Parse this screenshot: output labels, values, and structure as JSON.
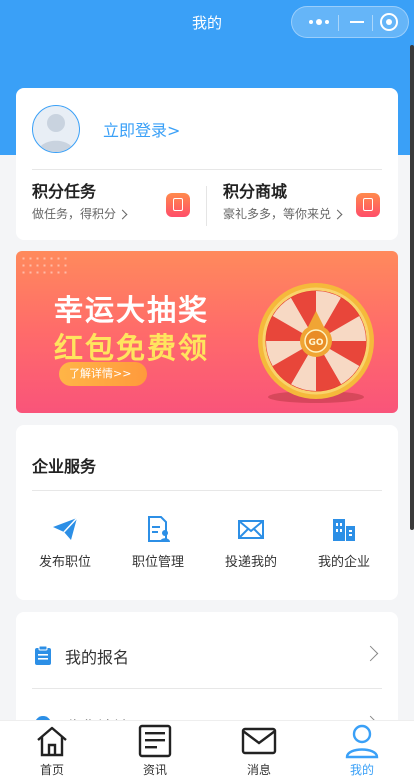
{
  "header": {
    "title": "我的",
    "accent_color": "#3aa0f7",
    "capsule": {
      "more_icon": "more-dots-icon",
      "minimize_icon": "minimize-icon",
      "close_icon": "target-close-icon"
    }
  },
  "profile": {
    "login_label": "立即登录>",
    "points_task": {
      "title": "积分任务",
      "subtitle": "做任务，得积分",
      "icon": "clipboard-icon"
    },
    "points_mall": {
      "title": "积分商城",
      "subtitle": "豪礼多多，等你来兑",
      "icon": "gift-bag-icon"
    }
  },
  "banner": {
    "line1": "幸运大抽奖",
    "line2": "红包免费领",
    "button_label": "了解详情>>",
    "wheel_center_label": "GO"
  },
  "services": {
    "title": "企业服务",
    "items": [
      {
        "label": "发布职位",
        "icon": "paper-plane-icon"
      },
      {
        "label": "职位管理",
        "icon": "document-person-icon"
      },
      {
        "label": "投递我的",
        "icon": "envelope-icon"
      },
      {
        "label": "我的企业",
        "icon": "building-icon"
      }
    ]
  },
  "list": [
    {
      "label": "我的报名",
      "icon": "clipboard-list-icon"
    },
    {
      "label": "收货地址",
      "icon": "location-pin-icon"
    }
  ],
  "tabbar": {
    "items": [
      {
        "label": "首页",
        "icon": "home-icon",
        "active": false
      },
      {
        "label": "资讯",
        "icon": "news-icon",
        "active": false
      },
      {
        "label": "消息",
        "icon": "mail-icon",
        "active": false
      },
      {
        "label": "我的",
        "icon": "user-icon",
        "active": true
      }
    ],
    "active_color": "#3aa0f7"
  }
}
